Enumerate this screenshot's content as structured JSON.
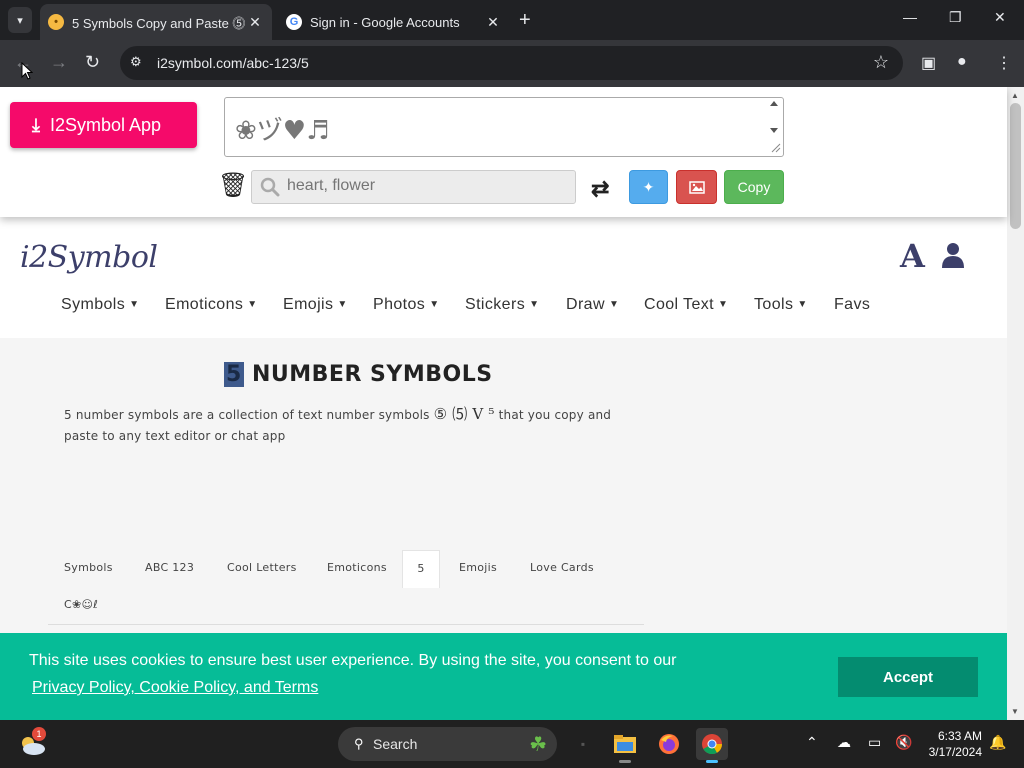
{
  "browser": {
    "tabs": [
      {
        "title": "5 Symbols Copy and Paste ⓹ ⑸",
        "favicon": "emoji-face",
        "active": true
      },
      {
        "title": "Sign in - Google Accounts",
        "favicon": "google-g",
        "active": false
      }
    ],
    "url": "i2symbol.com/abc-123/5"
  },
  "header": {
    "app_button": "I2Symbol App",
    "symbols_text": "❀ヅ♥♬",
    "search_placeholder": "heart, flower",
    "copy_label": "Copy"
  },
  "site": {
    "brand": "i2Symbol",
    "font_icon": "A",
    "nav": [
      "Symbols",
      "Emoticons",
      "Emojis",
      "Photos",
      "Stickers",
      "Draw",
      "Cool Text",
      "Tools",
      "Favs"
    ]
  },
  "main": {
    "heading_highlight": "5",
    "heading_text": "NUMBER SYMBOLS",
    "desc_before": "5 number symbols are a collection of text number symbols",
    "desc_symbols": "⑤ ⑸ Ⅴ ⁵",
    "desc_after": "that you copy and paste to any text editor or chat app",
    "tabs": [
      {
        "label": "Symbols",
        "active": false
      },
      {
        "label": "ABC 123",
        "active": false
      },
      {
        "label": "Cool Letters",
        "active": false
      },
      {
        "label": "Emoticons",
        "active": false
      },
      {
        "label": "5",
        "active": true
      },
      {
        "label": "Emojis",
        "active": false
      },
      {
        "label": "Love Cards",
        "active": false
      },
      {
        "label": "C❀☺ℓ",
        "active": false
      }
    ]
  },
  "cookie": {
    "message": "This site uses cookies to ensure best user experience. By using the site, you consent to our",
    "link": "Privacy Policy, Cookie Policy, and Terms",
    "accept": "Accept"
  },
  "taskbar": {
    "search_label": "Search",
    "weather_badge": "1",
    "time": "6:33 AM",
    "date": "3/17/2024"
  },
  "colors": {
    "app_button": "#f50a6a",
    "twitter": "#55acee",
    "image": "#d9534f",
    "copy": "#5cb85c",
    "cookie_bg": "#06bc97",
    "accept_bg": "#048c70",
    "brand": "#3c3f6a"
  }
}
